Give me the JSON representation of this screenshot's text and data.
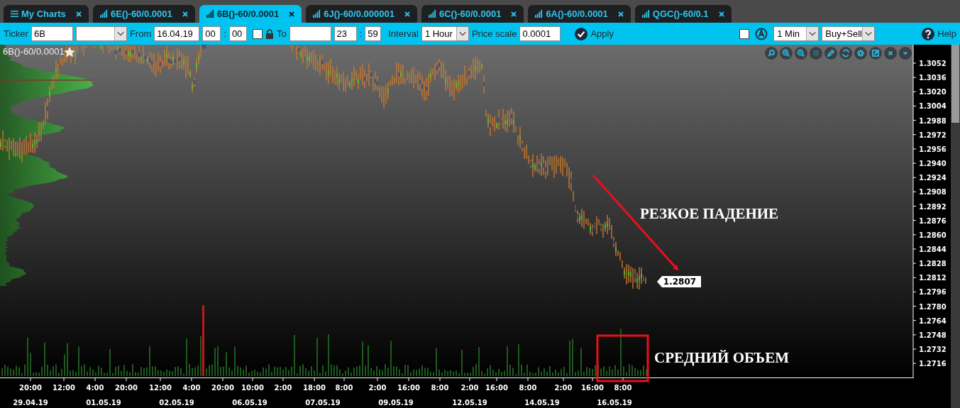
{
  "tabs": [
    {
      "label": "My Charts",
      "kind": "menu",
      "selected": false
    },
    {
      "label": "6E()-60/0.0001",
      "kind": "chart",
      "selected": false
    },
    {
      "label": "6B()-60/0.0001",
      "kind": "chart",
      "selected": true
    },
    {
      "label": "6J()-60/0.000001",
      "kind": "chart",
      "selected": false
    },
    {
      "label": "6C()-60/0.0001",
      "kind": "chart",
      "selected": false
    },
    {
      "label": "6A()-60/0.0001",
      "kind": "chart",
      "selected": false
    },
    {
      "label": "QGC()-60/0.1",
      "kind": "chart",
      "selected": false
    }
  ],
  "toolbar": {
    "ticker_label": "Ticker",
    "ticker": "6B",
    "from_label": "From",
    "from_date": "16.04.19",
    "from_hour": "00",
    "from_separator": ":",
    "from_minute": "00",
    "lock": {
      "checked": false
    },
    "to_label": "To",
    "to_hour": "23",
    "to_separator": ":",
    "to_minute": "59",
    "interval_label": "Interval",
    "interval": "1 Hour",
    "price_scale_label": "Price scale",
    "price_scale": "0.0001",
    "apply": "Apply",
    "auto": {
      "checked": false
    },
    "period": "1 Min",
    "side": "Buy+Sell",
    "help": "Help"
  },
  "chart": {
    "title": "6B()-60/0.0001",
    "last_price": "1.2807",
    "price_labels": [
      "1.3052",
      "1.3036",
      "1.3020",
      "1.3004",
      "1.2988",
      "1.2972",
      "1.2956",
      "1.2940",
      "1.2924",
      "1.2908",
      "1.2892",
      "1.2876",
      "1.2860",
      "1.2844",
      "1.2828",
      "1.2812",
      "1.2796",
      "1.2780",
      "1.2764",
      "1.2748",
      "1.2732",
      "1.2716"
    ],
    "time_labels": [
      "20:00",
      "12:00",
      "4:00",
      "20:00",
      "12:00",
      "4:00",
      "20:00",
      "10:00",
      "2:00",
      "18:00",
      "8:00",
      "2:00",
      "16:00",
      "8:00",
      "2:00",
      "16:00",
      "8:00",
      "2:00",
      "16:00",
      "8:00"
    ],
    "date_labels": [
      "29.04.19",
      "01.05.19",
      "02.05.19",
      "06.05.19",
      "07.05.19",
      "09.05.19",
      "12.05.19",
      "14.05.19",
      "16.05.19"
    ],
    "annotations": [
      {
        "kind": "arrow",
        "text": "РЕЗКОЕ ПАДЕНИЕ"
      },
      {
        "kind": "box",
        "text": "СРЕДНИЙ ОБЪЕМ"
      }
    ]
  }
}
